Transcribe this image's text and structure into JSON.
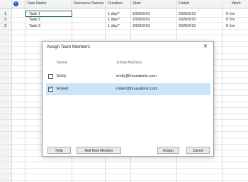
{
  "columns": {
    "info_icon": "info-icon",
    "task_name": "Task Name",
    "resource_names": "Resource Names",
    "duration": "Duration",
    "start": "Start",
    "finish": "Finish",
    "work": "Work"
  },
  "tasks": [
    {
      "id": "1",
      "name": "Task 1",
      "duration": "1 day?",
      "start": "2020/9/10",
      "finish": "2020/9/10",
      "work": "0 hrs"
    },
    {
      "id": "2",
      "name": "Task 2",
      "duration": "1 day?",
      "start": "2020/9/10",
      "finish": "2020/9/10",
      "work": "0 hrs"
    },
    {
      "id": "3",
      "name": "Task 3",
      "duration": "1 day?",
      "start": "2020/9/10",
      "finish": "2020/9/10",
      "work": "0 hrs"
    }
  ],
  "dialog": {
    "title": "Assign Team Members",
    "close_icon": "close-icon",
    "col_name": "Name",
    "col_email": "Email Address",
    "members": [
      {
        "name": "Emily",
        "email": "emily@housatonic.com",
        "checked": false
      },
      {
        "name": "Robert",
        "email": "robert@housatonic.com",
        "checked": true
      }
    ],
    "buttons": {
      "help": "Help",
      "add_new_member": "Add New Member",
      "assign": "Assign",
      "cancel": "Cancel"
    }
  },
  "colors": {
    "selected_row": "#cce4f7",
    "info_icon": "#1e5bb8",
    "selected_cell_border": "#217346"
  }
}
